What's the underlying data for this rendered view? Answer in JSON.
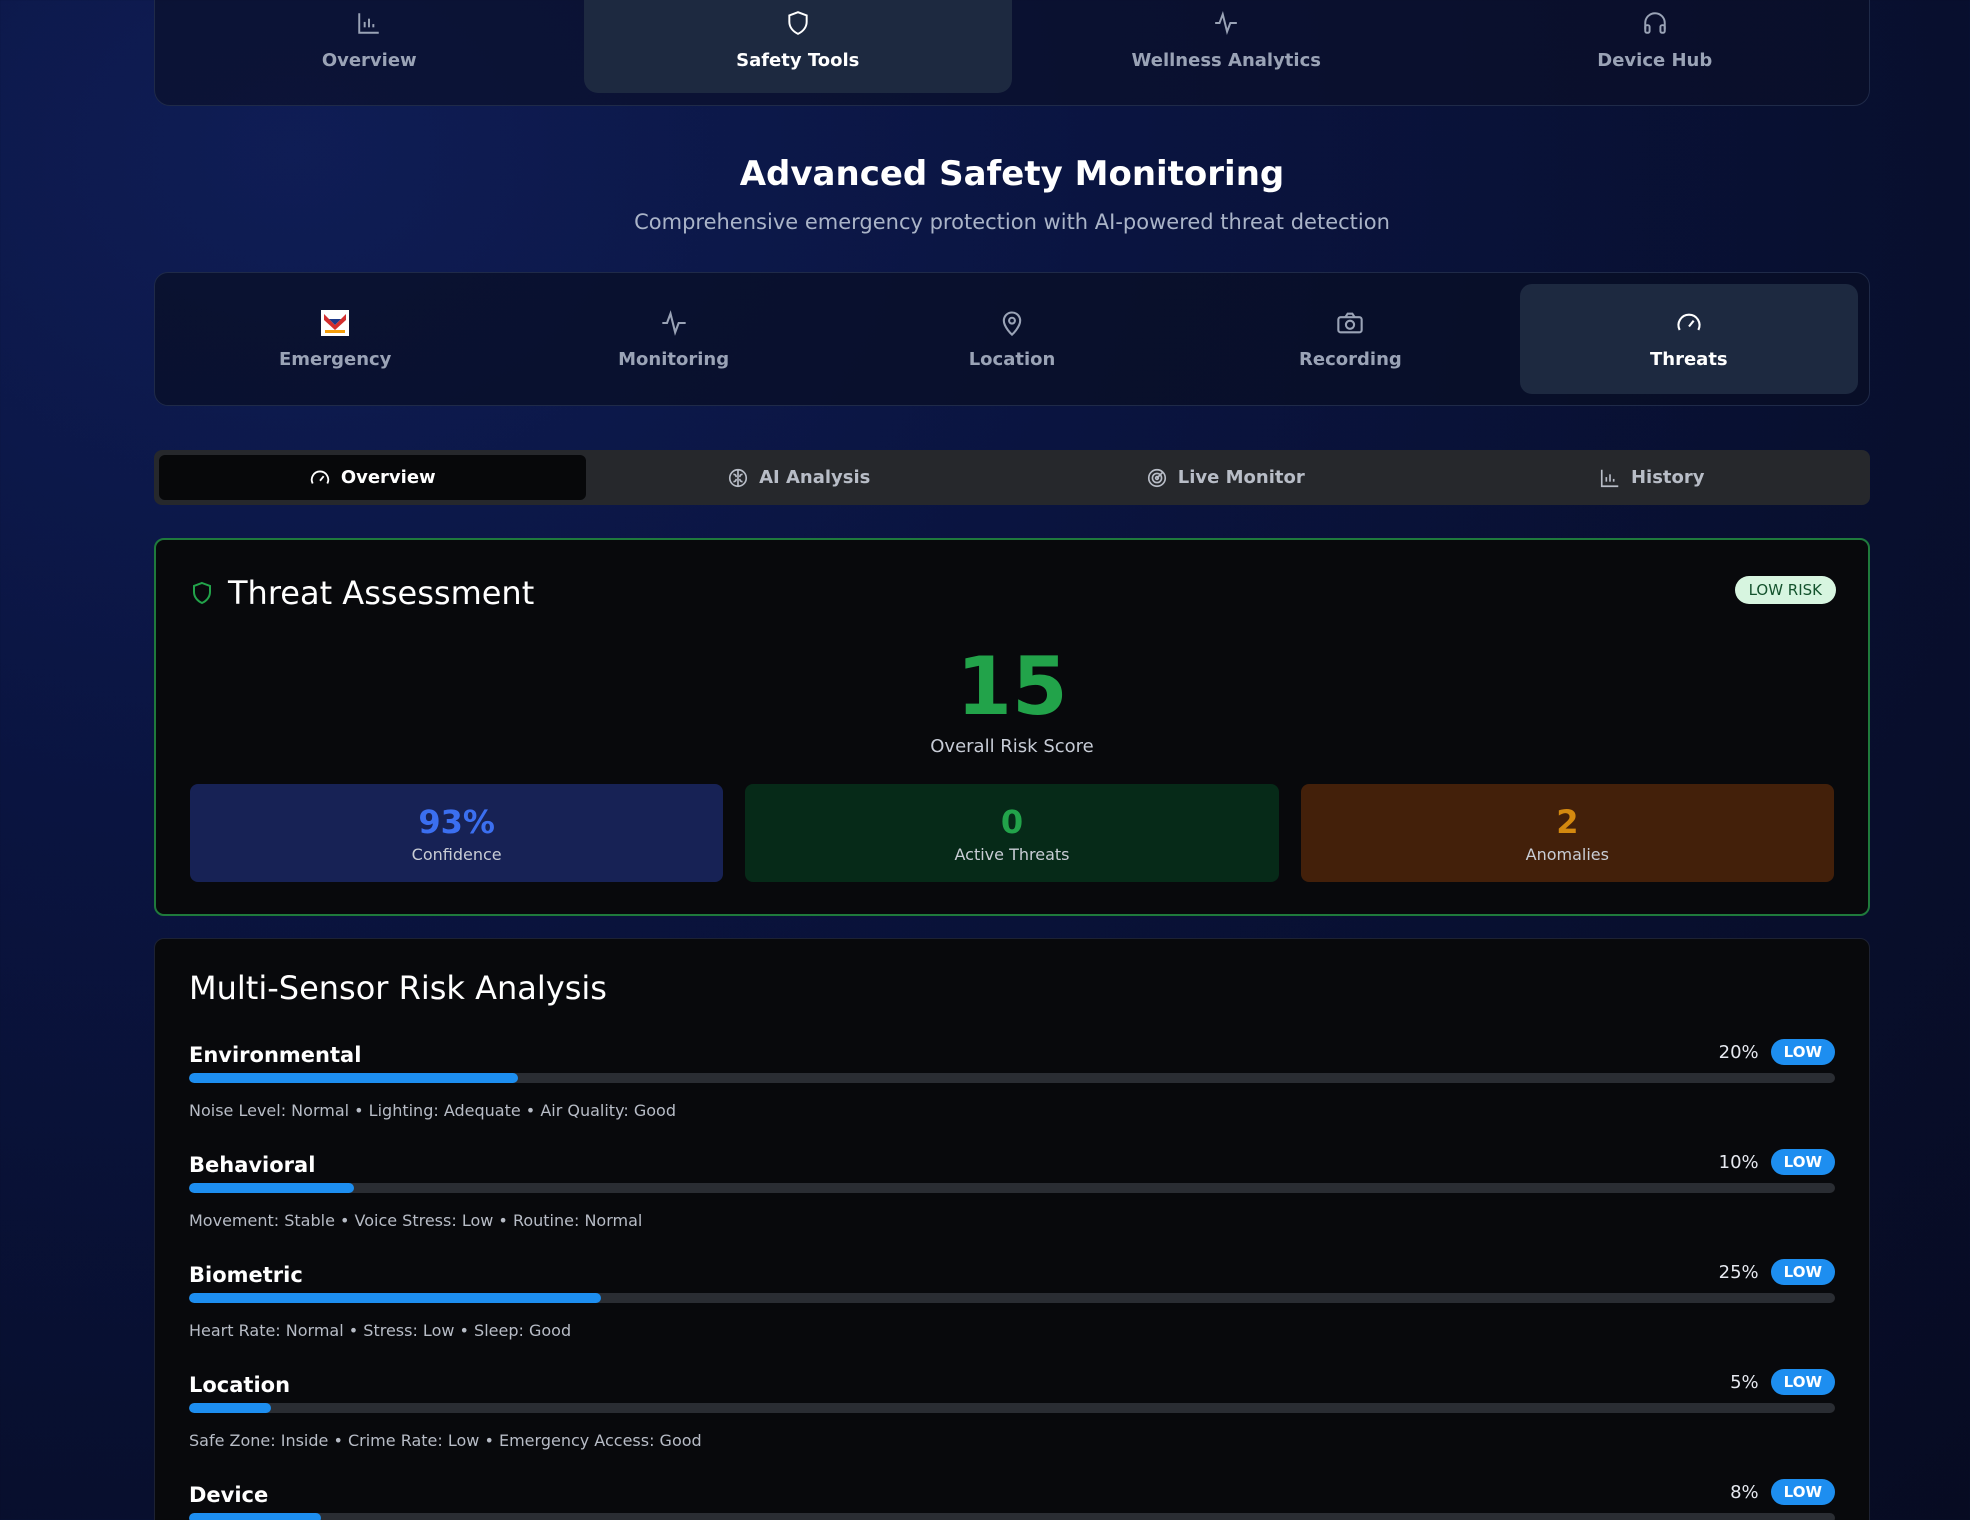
{
  "top_nav": [
    {
      "label": "Overview",
      "icon": "bar-chart-icon",
      "active": false
    },
    {
      "label": "Safety Tools",
      "icon": "shield-icon",
      "active": true
    },
    {
      "label": "Wellness Analytics",
      "icon": "activity-icon",
      "active": false
    },
    {
      "label": "Device Hub",
      "icon": "headphones-icon",
      "active": false
    }
  ],
  "page_title": "Advanced Safety Monitoring",
  "page_subtitle": "Comprehensive emergency protection with AI-powered threat detection",
  "tool_tabs": [
    {
      "label": "Emergency",
      "icon": "emergency-image-icon",
      "active": false
    },
    {
      "label": "Monitoring",
      "icon": "activity-icon",
      "active": false
    },
    {
      "label": "Location",
      "icon": "map-pin-icon",
      "active": false
    },
    {
      "label": "Recording",
      "icon": "camera-icon",
      "active": false
    },
    {
      "label": "Threats",
      "icon": "gauge-icon",
      "active": true
    }
  ],
  "sub_tabs": [
    {
      "label": "Overview",
      "icon": "gauge-icon",
      "active": true
    },
    {
      "label": "AI Analysis",
      "icon": "brain-icon",
      "active": false
    },
    {
      "label": "Live Monitor",
      "icon": "radar-icon",
      "active": false
    },
    {
      "label": "History",
      "icon": "bar-chart-icon",
      "active": false
    }
  ],
  "threat": {
    "title": "Threat Assessment",
    "risk_badge": "LOW RISK",
    "score": "15",
    "score_label": "Overall Risk Score",
    "stats": [
      {
        "value": "93%",
        "label": "Confidence"
      },
      {
        "value": "0",
        "label": "Active Threats"
      },
      {
        "value": "2",
        "label": "Anomalies"
      }
    ]
  },
  "sensors": {
    "title": "Multi-Sensor Risk Analysis",
    "rows": [
      {
        "name": "Environmental",
        "percent": "20%",
        "level": "LOW",
        "fill": 0.2,
        "desc": "Noise Level: Normal • Lighting: Adequate • Air Quality: Good"
      },
      {
        "name": "Behavioral",
        "percent": "10%",
        "level": "LOW",
        "fill": 0.1,
        "desc": "Movement: Stable • Voice Stress: Low • Routine: Normal"
      },
      {
        "name": "Biometric",
        "percent": "25%",
        "level": "LOW",
        "fill": 0.25,
        "desc": "Heart Rate: Normal • Stress: Low • Sleep: Good"
      },
      {
        "name": "Location",
        "percent": "5%",
        "level": "LOW",
        "fill": 0.05,
        "desc": "Safe Zone: Inside • Crime Rate: Low • Emergency Access: Good"
      },
      {
        "name": "Device",
        "percent": "8%",
        "level": "LOW",
        "fill": 0.08,
        "desc": ""
      }
    ]
  }
}
